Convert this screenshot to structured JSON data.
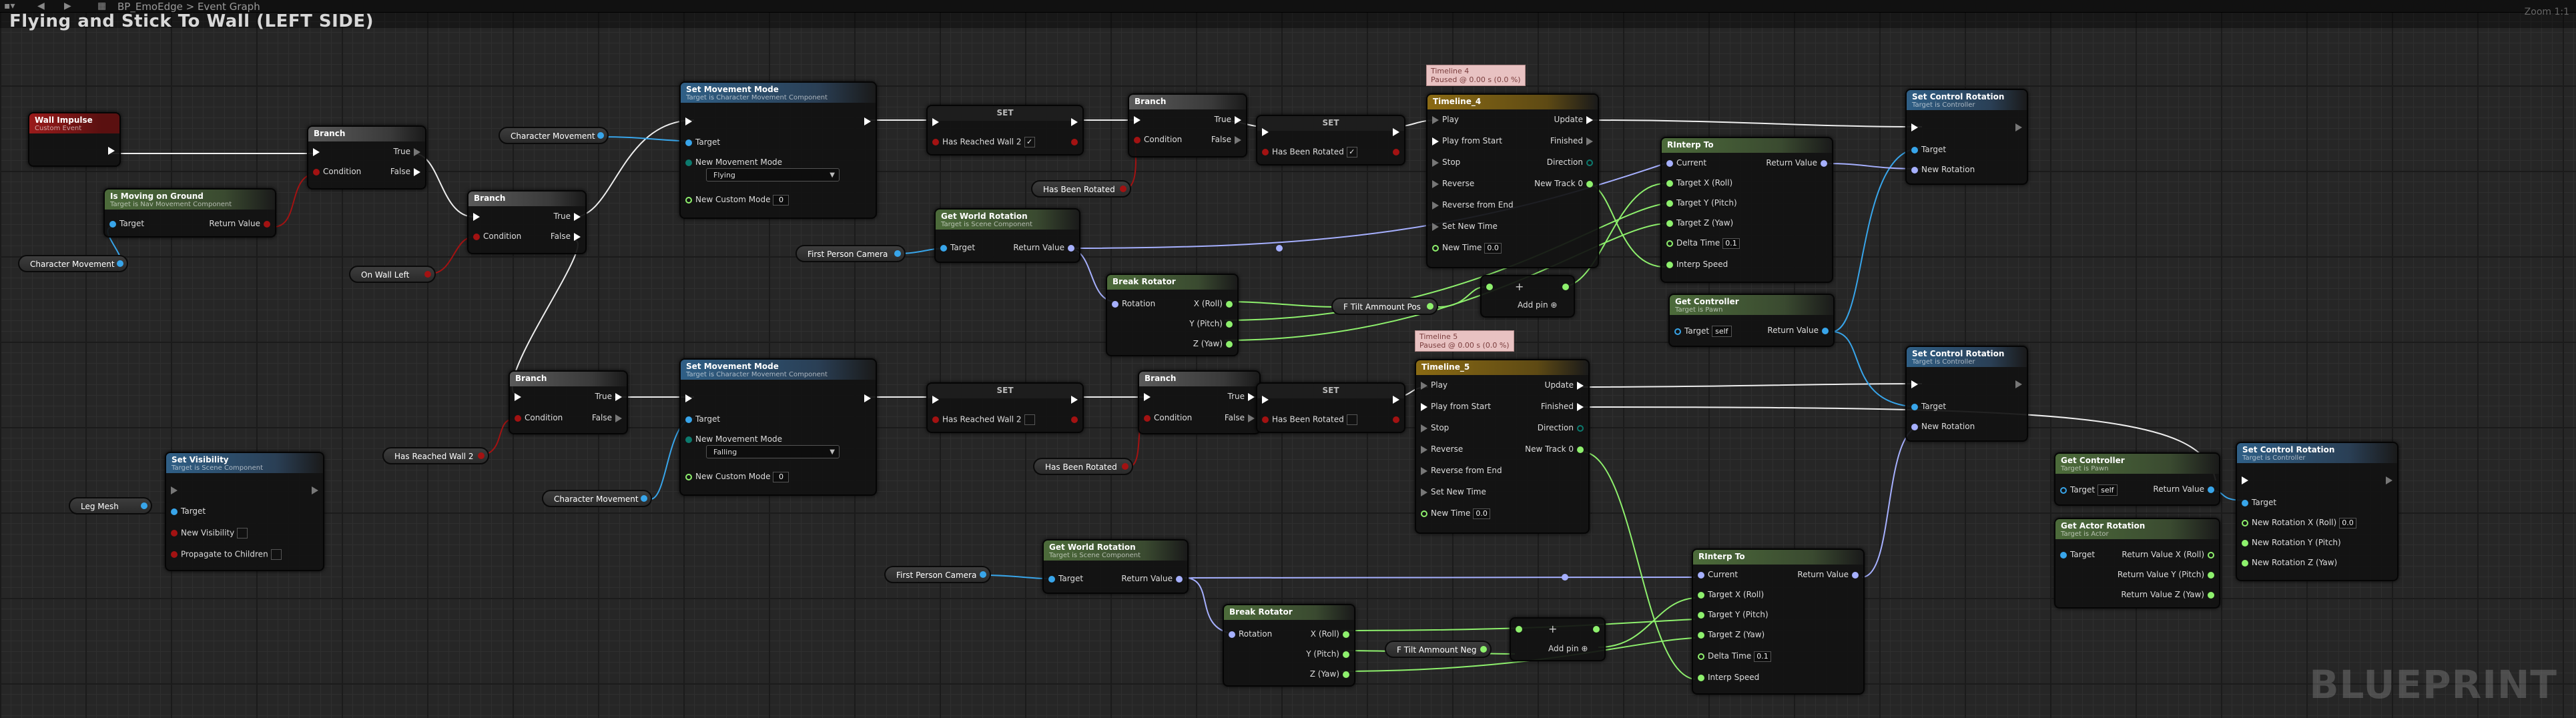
{
  "editor": {
    "breadcrumb": "BP_EmoEdge > Event Graph",
    "graph_title": "Flying and Stick To Wall (LEFT SIDE)",
    "zoom": "Zoom 1:1",
    "watermark": "BLUEPRINT"
  },
  "nodes": {
    "wall_impulse": {
      "title": "Wall Impulse",
      "subtitle": "Custom Event"
    },
    "is_moving_on_ground": {
      "title": "Is Moving on Ground",
      "subtitle": "Target is Nav Movement Component",
      "target": "Target",
      "ret": "Return Value"
    },
    "branch1": {
      "title": "Branch",
      "condition": "Condition",
      "true": "True",
      "false": "False"
    },
    "branch2": {
      "title": "Branch",
      "condition": "Condition",
      "true": "True",
      "false": "False"
    },
    "branch3": {
      "title": "Branch",
      "condition": "Condition",
      "true": "True",
      "false": "False"
    },
    "branch4": {
      "title": "Branch",
      "condition": "Condition",
      "true": "True",
      "false": "False"
    },
    "branch5": {
      "title": "Branch",
      "condition": "Condition",
      "true": "True",
      "false": "False"
    },
    "set_movement_mode1": {
      "title": "Set Movement Mode",
      "subtitle": "Target is Character Movement Component",
      "target": "Target",
      "new_mode": "New Movement Mode",
      "mode_value": "Flying",
      "custom_mode": "New Custom Mode",
      "custom_value": "0"
    },
    "set_movement_mode2": {
      "title": "Set Movement Mode",
      "subtitle": "Target is Character Movement Component",
      "target": "Target",
      "new_mode": "New Movement Mode",
      "mode_value": "Falling",
      "custom_mode": "New Custom Mode",
      "custom_value": "0"
    },
    "set_reached1": {
      "title": "SET",
      "label": "Has Reached Wall 2"
    },
    "set_reached2": {
      "title": "SET",
      "label": "Has Reached Wall 2"
    },
    "set_rotated1": {
      "title": "SET",
      "label": "Has Been Rotated"
    },
    "set_rotated2": {
      "title": "SET",
      "label": "Has Been Rotated"
    },
    "get_world_rotation1": {
      "title": "Get World Rotation",
      "subtitle": "Target is Scene Component",
      "target": "Target",
      "ret": "Return Value"
    },
    "get_world_rotation2": {
      "title": "Get World Rotation",
      "subtitle": "Target is Scene Component",
      "target": "Target",
      "ret": "Return Value"
    },
    "break_rotator1": {
      "title": "Break Rotator",
      "rotation": "Rotation",
      "x": "X (Roll)",
      "y": "Y (Pitch)",
      "z": "Z (Yaw)"
    },
    "break_rotator2": {
      "title": "Break Rotator",
      "rotation": "Rotation",
      "x": "X (Roll)",
      "y": "Y (Pitch)",
      "z": "Z (Yaw)"
    },
    "timeline4": {
      "title": "Timeline_4",
      "note_title": "Timeline 4",
      "note_status": "Paused @ 0.00 s (0.0 %)",
      "play": "Play",
      "play_from_start": "Play from Start",
      "stop": "Stop",
      "reverse": "Reverse",
      "reverse_from_end": "Reverse from End",
      "set_new_time": "Set New Time",
      "new_time": "New Time",
      "new_time_value": "0.0",
      "update": "Update",
      "finished": "Finished",
      "direction": "Direction",
      "new_track": "New Track 0"
    },
    "timeline5": {
      "title": "Timeline_5",
      "note_title": "Timeline 5",
      "note_status": "Paused @ 0.00 s (0.0 %)",
      "play": "Play",
      "play_from_start": "Play from Start",
      "stop": "Stop",
      "reverse": "Reverse",
      "reverse_from_end": "Reverse from End",
      "set_new_time": "Set New Time",
      "new_time": "New Time",
      "new_time_value": "0.0",
      "update": "Update",
      "finished": "Finished",
      "direction": "Direction",
      "new_track": "New Track 0"
    },
    "rinterp1": {
      "title": "RInterp To",
      "current": "Current",
      "tx": "Target X (Roll)",
      "ty": "Target Y (Pitch)",
      "tz": "Target Z (Yaw)",
      "delta": "Delta Time",
      "delta_value": "0.1",
      "speed": "Interp Speed",
      "ret": "Return Value"
    },
    "rinterp2": {
      "title": "RInterp To",
      "current": "Current",
      "tx": "Target X (Roll)",
      "ty": "Target Y (Pitch)",
      "tz": "Target Z (Yaw)",
      "delta": "Delta Time",
      "delta_value": "0.1",
      "speed": "Interp Speed",
      "ret": "Return Value"
    },
    "get_controller1": {
      "title": "Get Controller",
      "subtitle": "Target is Pawn",
      "target": "Target",
      "self": "self",
      "ret": "Return Value"
    },
    "get_controller2": {
      "title": "Get Controller",
      "subtitle": "Target is Pawn",
      "target": "Target",
      "self": "self",
      "ret": "Return Value"
    },
    "set_control_rotation1": {
      "title": "Set Control Rotation",
      "subtitle": "Target is Controller",
      "target": "Target",
      "new_rotation": "New Rotation"
    },
    "set_control_rotation2": {
      "title": "Set Control Rotation",
      "subtitle": "Target is Controller",
      "target": "Target",
      "new_rotation": "New Rotation"
    },
    "set_control_rotation3": {
      "title": "Set Control Rotation",
      "subtitle": "Target is Controller",
      "target": "Target",
      "nrx": "New Rotation X (Roll)",
      "nrx_value": "0.0",
      "nry": "New Rotation Y (Pitch)",
      "nrz": "New Rotation Z (Yaw)"
    },
    "get_actor_rotation": {
      "title": "Get Actor Rotation",
      "subtitle": "Target is Actor",
      "target": "Target",
      "rx": "Return Value X (Roll)",
      "ry": "Return Value Y (Pitch)",
      "rz": "Return Value Z (Yaw)"
    },
    "set_visibility": {
      "title": "Set Visibility",
      "subtitle": "Target is Scene Component",
      "target": "Target",
      "new_visibility": "New Visibility",
      "propagate": "Propagate to Children"
    },
    "make_array1": {
      "add_pin": "Add pin"
    },
    "make_array2": {
      "add_pin": "Add pin"
    }
  },
  "variables": {
    "character_movement": "Character Movement",
    "on_wall_left": "On Wall Left",
    "has_been_rotated": "Has Been Rotated",
    "first_person_camera": "First Person Camera",
    "f_tilt_pos": "F Tilt Ammount Pos",
    "f_tilt_neg": "F Tilt Ammount Neg",
    "has_reached_wall": "Has Reached Wall 2",
    "leg_mesh": "Leg Mesh"
  },
  "colors": {
    "exec": "#ffffff",
    "bool": "#a31212",
    "object": "#38a5ea",
    "float": "#8ef06d",
    "rotator": "#a6b0ff",
    "function_header": "#2f5f86",
    "pure_header": "#4c6b3a",
    "event_header": "#9a1b1b",
    "timeline_header": "#8a6a14"
  }
}
